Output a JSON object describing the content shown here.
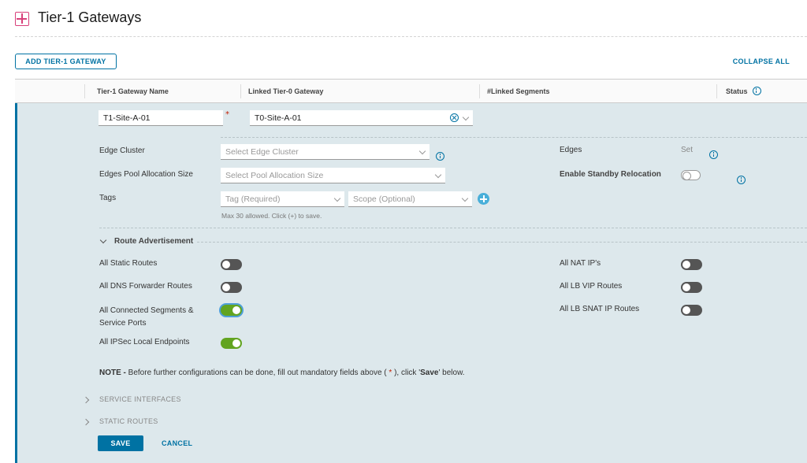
{
  "page": {
    "title": "Tier-1 Gateways"
  },
  "toolbar": {
    "add_label": "ADD TIER-1 GATEWAY",
    "collapse_label": "COLLAPSE ALL"
  },
  "table": {
    "columns": [
      "Tier-1 Gateway Name",
      "Linked Tier-0 Gateway",
      "#Linked Segments",
      "Status"
    ]
  },
  "row": {
    "name_value": "T1-Site-A-01",
    "required_mark": "*",
    "tier0_value": "T0-Site-A-01",
    "edge_cluster_label": "Edge Cluster",
    "edge_cluster_placeholder": "Select Edge Cluster",
    "pool_label": "Edges Pool Allocation Size",
    "pool_placeholder": "Select Pool Allocation Size",
    "tags_label": "Tags",
    "tag_placeholder": "Tag (Required)",
    "scope_placeholder": "Scope (Optional)",
    "tags_hint": "Max 30 allowed. Click (+) to save.",
    "edges_label": "Edges",
    "edges_value": "Set",
    "standby_label": "Enable Standby Relocation",
    "standby_on": false
  },
  "route_adv": {
    "title": "Route Advertisement",
    "left": [
      {
        "label": "All Static Routes",
        "on": false
      },
      {
        "label": "All DNS Forwarder Routes",
        "on": false
      },
      {
        "label": "All Connected Segments & Service Ports",
        "on": true
      },
      {
        "label": "All IPSec Local Endpoints",
        "on": true
      }
    ],
    "right": [
      {
        "label": "All NAT IP's",
        "on": false
      },
      {
        "label": "All LB VIP Routes",
        "on": false
      },
      {
        "label": "All LB SNAT IP Routes",
        "on": false
      }
    ]
  },
  "note": {
    "prefix": "NOTE -",
    "text1": " Before further configurations can be done, fill out mandatory fields above ( ",
    "star": "*",
    "text2": " ), click '",
    "save_word": "Save",
    "text3": "' below."
  },
  "sections": [
    "SERVICE INTERFACES",
    "STATIC ROUTES"
  ],
  "actions": {
    "save_label": "SAVE",
    "cancel_label": "CANCEL"
  },
  "colors": {
    "accent": "#0072a3",
    "toggle_on": "#62a420",
    "panel_bg": "#dde8ec",
    "brand_icon": "#d8407a"
  }
}
